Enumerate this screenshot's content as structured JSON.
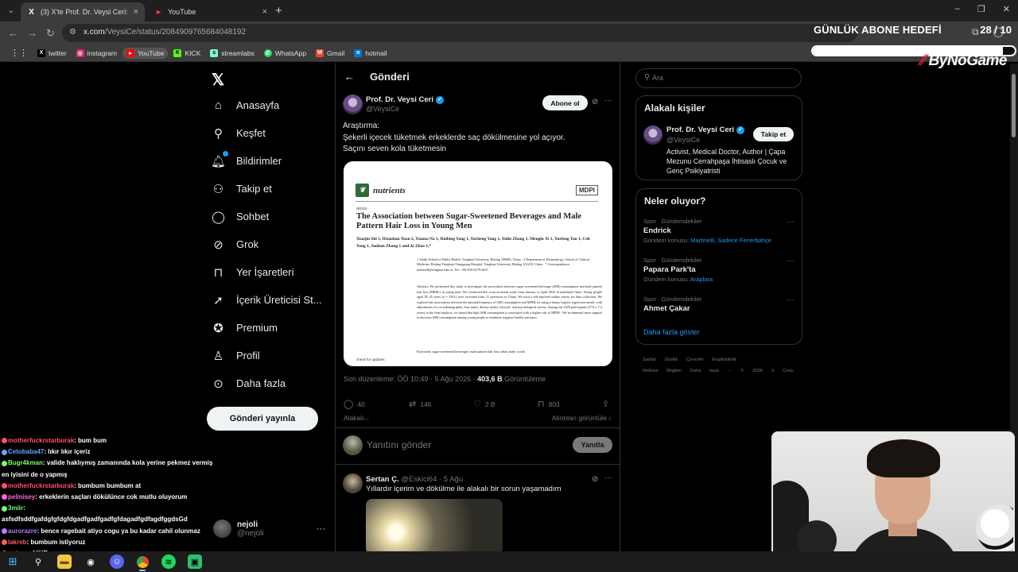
{
  "browser": {
    "tabs": [
      {
        "title": "(3) X'te Prof. Dr. Veysi Ceri: \"Ara",
        "favicon": "x-icon",
        "close": "×"
      },
      {
        "title": "YouTube",
        "favicon": "youtube-icon",
        "close": "×"
      }
    ],
    "new_tab": "+",
    "window_controls": [
      "–",
      "❐",
      "✕"
    ],
    "url_host": "x.com",
    "url_path": "/VeysiCe/status/2084909765684048192",
    "bookmarks": [
      {
        "label": "twitter",
        "icon": "x-icon",
        "color": "#000000"
      },
      {
        "label": "instagram",
        "icon": "instagram-icon",
        "color": "#d62976"
      },
      {
        "label": "YouTube",
        "icon": "youtube-icon",
        "color": "#ff0000"
      },
      {
        "label": "KICK",
        "icon": "kick-icon",
        "color": "#53fc18"
      },
      {
        "label": "streamlabs",
        "icon": "streamlabs-icon",
        "color": "#80f5d2"
      },
      {
        "label": "WhatsApp",
        "icon": "whatsapp-icon",
        "color": "#25d366"
      },
      {
        "label": "Gmail",
        "icon": "gmail-icon",
        "color": "#ea4335"
      },
      {
        "label": "hotmail",
        "icon": "outlook-icon",
        "color": "#0078d4"
      }
    ]
  },
  "overlay": {
    "goal_title": "GÜNLÜK ABONE HEDEFİ",
    "goal_count": "28 / 10",
    "goal_fill_fraction": 0.94,
    "brand_a": "By",
    "brand_b": "No",
    "brand_c": "Game"
  },
  "nav": {
    "items": [
      {
        "label": "Anasayfa",
        "icon": "home-icon"
      },
      {
        "label": "Keşfet",
        "icon": "search-icon"
      },
      {
        "label": "Bildirimler",
        "icon": "bell-icon"
      },
      {
        "label": "Takip et",
        "icon": "follow-icon"
      },
      {
        "label": "Sohbet",
        "icon": "chat-icon"
      },
      {
        "label": "Grok",
        "icon": "grok-icon"
      },
      {
        "label": "Yer İşaretleri",
        "icon": "bookmark-icon"
      },
      {
        "label": "İçerik Üreticisi St...",
        "icon": "rocket-icon"
      },
      {
        "label": "Premium",
        "icon": "premium-icon"
      },
      {
        "label": "Profil",
        "icon": "profile-icon"
      },
      {
        "label": "Daha fazla",
        "icon": "more-icon"
      }
    ],
    "post_button": "Gönderi yayınla",
    "account_name": "nejoli",
    "account_handle": "@nejoli",
    "account_more": "···"
  },
  "chat": [
    {
      "user": "motherfuckrstarburak",
      "msg": ": bum bum",
      "color": "#ff4f6d"
    },
    {
      "user": "Cetobaba47",
      "msg": ": lıkır lıkır içeriz",
      "color": "#5fa8ff"
    },
    {
      "user": "Bugr4kman",
      "msg": ": valide haklıymış zamanında kola yerine pekmez vermiş",
      "color": "#7dff62"
    },
    {
      "user": "",
      "msg": "en iyisini de o yapmış",
      "color": "#ffffff"
    },
    {
      "user": "motherfuckrstarburak",
      "msg": ": bumbum bumbum at",
      "color": "#ff4f6d"
    },
    {
      "user": "pelinisey",
      "msg": ": erkeklerin saçları dökülünce cok mutlu oluyorum",
      "color": "#ff6ad5"
    },
    {
      "user": "3miir",
      "msg": ":",
      "color": "#7dff62"
    },
    {
      "user": "",
      "msg": "asfsdfsddfgafdgfgfdgfdgadfgadfgadfgfdagadfgdfagdfggdsGd",
      "color": "#ffffff"
    },
    {
      "user": "aurorazre",
      "msg": ": bence ragebait atiyo cogu ya bu kadar cahil olunmaz",
      "color": "#b27dff"
    },
    {
      "user": "lakreb",
      "msg": ": bumbum istiyoruz",
      "color": "#ff5c5c"
    },
    {
      "user": "ardaxn",
      "msg": ": NIYE",
      "color": "#ff4f4f"
    }
  ],
  "post": {
    "header_title": "Gönderi",
    "author": "Prof. Dr. Veysi Ceri",
    "handle": "@VeysiCe",
    "subscribe": "Abone ol",
    "text_1": "Araştırma:",
    "text_2": "Şekerli içecek tüketmek erkeklerde saç dökülmesine yol açıyor.",
    "text_3": "Saçını seven kola tüketmesin",
    "meta_prefix": "Son düzenleme: ÖÖ 10:49 · 5 Ağu 2026 · ",
    "views": "403,6 B",
    "views_label": " Görüntüleme",
    "replies": "40",
    "reposts": "146",
    "likes": "2 B",
    "bookmarks": "803",
    "sub_label": "Alakalı⌵",
    "quotes_label": "Alıntıları görüntüle ›",
    "reply_placeholder": "Yanıtını gönder",
    "reply_button": "Yanıtla"
  },
  "paper": {
    "journal": "nutrients",
    "publisher": "MDPI",
    "kind": "Article",
    "title": "The Association between Sugar-Sweetened Beverages and Male Pattern Hair Loss in Young Men",
    "authors": "Xiaojin Shi 1, Hsiaohan Tuan 2, Xiaona Na 1, Haibing Yang 1, Yucheng Yang 1, Yulin Zhang 1, Menglu Xi 1, Yuefeng Tan 1, Celi Yang 1, Junhan Zhang 1 and Ai Zhao 1,*",
    "affiliations": "1 Vanke School of Public Health, Tsinghua University, Beijing 100084, China · 2 Department of Dermatology, School of Clinical Medicine, Beijing Tsinghua Changgung Hospital, Tsinghua University, Beijing 102218, China · * Correspondence: aizhao18@tsinghua.edu.cn; Tel.: +86-010-6279-4447",
    "abstract": "Abstract: We performed this study to investigate the association between sugar-sweetened beverage (SSB) consumption and male pattern hair loss (MPHL) in young men. We conducted this cross-sectional study from January to April 2022 in mainland China. Young people aged 18–45 years (n = 1951) were recruited from 31 provinces in China. We used a self-reported online survey for data collection. We explored the associations between the amount/frequency of SSB consumption and MPHL by using a binary logistic regression model, with adjustments for sociodemographic, hair status, dietary intake, lifestyle, and psychological factors. Among the 1028 participants (27.8 ± 7.2 years) in the final analysis, we found that high SSB consumption is associated with a higher risk of MPHL. We recommend more support to decrease SSB consumption among young people to minimize negative health outcomes.",
    "keywords": "Keywords: sugar-sweetened beverages; male pattern hair loss; adult; male; youth",
    "check": "check for updates"
  },
  "comment": {
    "name": "Sertan Ç.",
    "handle_time": " @Eskici64 · 5 Ağu",
    "text": "Yıllardır içerim ve dökülme ile alakalı bir sorun yaşamadım"
  },
  "sidebar": {
    "search_placeholder": "Ara",
    "related_title": "Alakalı kişiler",
    "rp_name": "Prof. Dr. Veysi Ceri",
    "rp_handle": "@VeysiCe",
    "follow": "Takip et",
    "rp_bio": "Activist, Medical Doctor, Author | Çapa Mezunu Cerrahpaşa İhtisaslı Çocuk ve Genç Psikiyatristi",
    "trends_title": "Neler oluyor?",
    "trends": [
      {
        "category": "Spor · Gündemdekiler",
        "name": "Endrick",
        "related_prefix": "Gündem konusu: ",
        "related": "Martinelli, Sadece Fenerbahçe"
      },
      {
        "category": "Spor · Gündemdekiler",
        "name": "Papara Park'ta",
        "related_prefix": "Gündem konusu: ",
        "related": "Araplara"
      },
      {
        "category": "Spor · Gündemdekiler",
        "name": "Ahmet Çakar",
        "related_prefix": "",
        "related": ""
      }
    ],
    "show_more": "Daha fazla göster",
    "footer_1": "Şartlar  Gizlilik  Çerezler  Erişilebilirlik",
    "footer_2": "Reklam Bilgileri  Daha fazla ···  © 2026 X Corp."
  }
}
